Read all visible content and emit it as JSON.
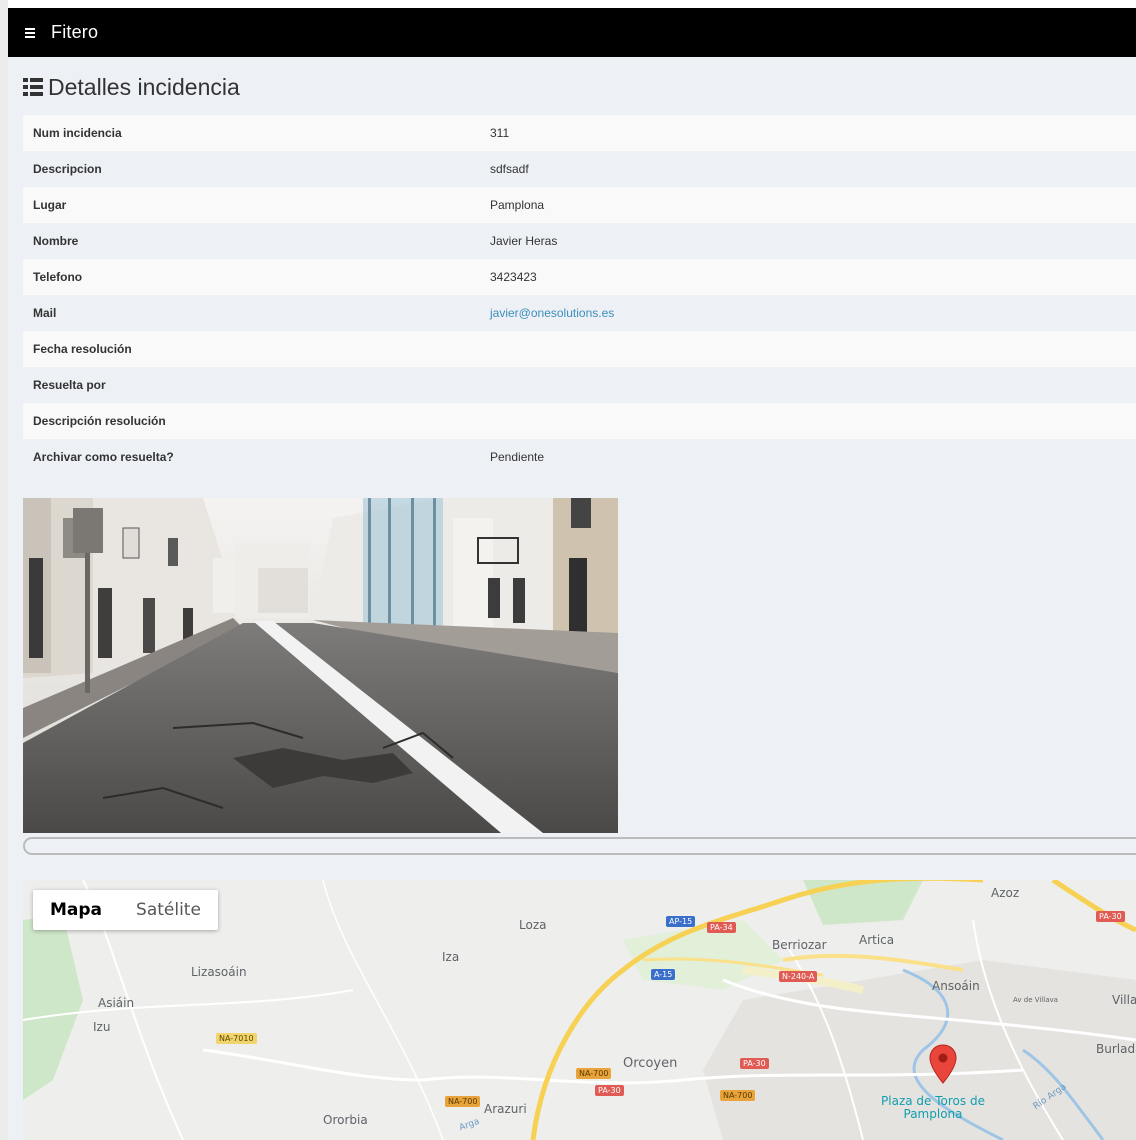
{
  "app": {
    "title": "Fitero",
    "menu_icon": "hamburger-icon"
  },
  "page": {
    "title": "Detalles incidencia",
    "title_icon": "list-icon"
  },
  "details": [
    {
      "label": "Num incidencia",
      "value": "311"
    },
    {
      "label": "Descripcion",
      "value": "sdfsadf"
    },
    {
      "label": "Lugar",
      "value": "Pamplona"
    },
    {
      "label": "Nombre",
      "value": "Javier Heras"
    },
    {
      "label": "Telefono",
      "value": "3423423"
    },
    {
      "label": "Mail",
      "value": "javier@onesolutions.es",
      "is_link": true
    },
    {
      "label": "Fecha resolución",
      "value": ""
    },
    {
      "label": "Resuelta por",
      "value": ""
    },
    {
      "label": "Descripción resolución",
      "value": ""
    },
    {
      "label": "Archivar como resuelta?",
      "value": "Pendiente"
    }
  ],
  "map": {
    "type_control": {
      "map_label": "Mapa",
      "satellite_label": "Satélite",
      "selected": "Mapa"
    },
    "places": [
      "Azoz",
      "Loza",
      "Artica",
      "Berriozar",
      "Iza",
      "Lizasoáin",
      "Ansoáin",
      "Asiáin",
      "Izu",
      "Villa",
      "Burlada",
      "Orcoyen",
      "Arazuri",
      "Ororbia",
      "Av de Villava",
      "Río Arga",
      "Arga"
    ],
    "roads": [
      "AP-15",
      "PA-34",
      "PA-30",
      "A-15",
      "N-240-A",
      "NA-7010",
      "NA-700",
      "PA-30",
      "NA-700",
      "NA-700",
      "PA-30"
    ],
    "poi": "Plaza de Toros de Pamplona",
    "marker_icon": "map-marker-icon",
    "colors": {
      "marker": "#e9453a",
      "road_major": "#f7d154",
      "park": "#c8e6c2"
    }
  }
}
